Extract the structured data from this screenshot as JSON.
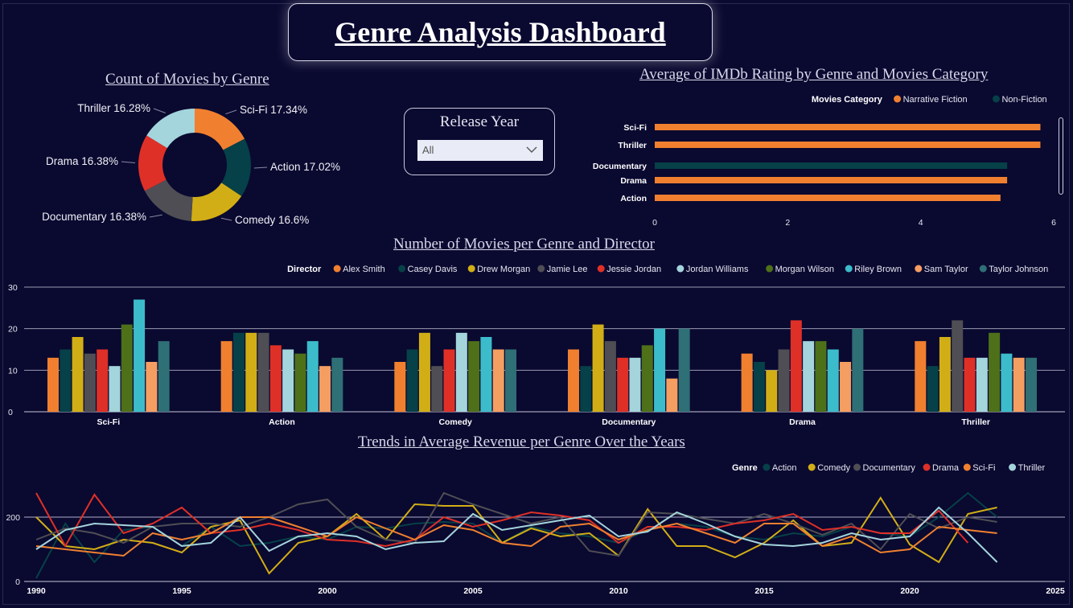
{
  "dashboard": {
    "title": "Genre Analysis Dashboard"
  },
  "slicer": {
    "title": "Release Year",
    "value": "All"
  },
  "donut": {
    "title": "Count of Movies by Genre",
    "chart_data": {
      "type": "pie",
      "title": "Count of Movies by Genre",
      "slices": [
        {
          "label": "Sci-Fi",
          "value": 17.34,
          "text": "Sci-Fi 17.34%",
          "color": "#f0802f"
        },
        {
          "label": "Action",
          "value": 17.02,
          "text": "Action 17.02%",
          "color": "#064048"
        },
        {
          "label": "Comedy",
          "value": 16.6,
          "text": "Comedy 16.6%",
          "color": "#d2ae16"
        },
        {
          "label": "Documentary",
          "value": 16.38,
          "text": "Documentary 16.38%",
          "color": "#4e4e54"
        },
        {
          "label": "Drama",
          "value": 16.38,
          "text": "Drama 16.38%",
          "color": "#df3027"
        },
        {
          "label": "Thriller",
          "value": 16.28,
          "text": "Thriller 16.28%",
          "color": "#a4d4dc"
        }
      ]
    }
  },
  "imdb": {
    "title": "Average of IMDb Rating by Genre and Movies Category",
    "legend_title": "Movies Category",
    "chart_data": {
      "type": "bar",
      "orientation": "horizontal",
      "title": "Average of IMDb Rating by Genre and Movies Category",
      "categories": [
        "Sci-Fi",
        "Thriller",
        "Documentary",
        "Drama",
        "Action"
      ],
      "series": [
        {
          "name": "Narrative Fiction",
          "color": "#f0802f",
          "values": [
            5.8,
            5.8,
            null,
            5.3,
            5.2
          ]
        },
        {
          "name": "Non-Fiction",
          "color": "#064048",
          "values": [
            null,
            null,
            5.3,
            null,
            null
          ]
        }
      ],
      "xlim": [
        0,
        6
      ],
      "xticks": [
        "0",
        "2",
        "4",
        "6"
      ]
    }
  },
  "director": {
    "title": "Number of Movies per Genre and Director",
    "legend_title": "Director",
    "chart_data": {
      "type": "bar",
      "title": "Number of Movies per Genre and Director",
      "categories": [
        "Sci-Fi",
        "Action",
        "Comedy",
        "Documentary",
        "Drama",
        "Thriller"
      ],
      "ylim": [
        0,
        30
      ],
      "yticks": [
        "0",
        "10",
        "20",
        "30"
      ],
      "grid": true,
      "series": [
        {
          "name": "Alex Smith",
          "color": "#f0802f",
          "values": [
            13,
            17,
            12,
            15,
            14,
            17
          ]
        },
        {
          "name": "Casey Davis",
          "color": "#064048",
          "values": [
            15,
            19,
            15,
            11,
            12,
            11
          ]
        },
        {
          "name": "Drew Morgan",
          "color": "#d2ae16",
          "values": [
            18,
            19,
            19,
            21,
            10,
            18
          ]
        },
        {
          "name": "Jamie Lee",
          "color": "#4e4e54",
          "values": [
            14,
            19,
            11,
            17,
            15,
            22
          ]
        },
        {
          "name": "Jessie Jordan",
          "color": "#df3027",
          "values": [
            15,
            16,
            15,
            13,
            22,
            13
          ]
        },
        {
          "name": "Jordan Williams",
          "color": "#a4d4dc",
          "values": [
            11,
            15,
            19,
            13,
            17,
            13
          ]
        },
        {
          "name": "Morgan Wilson",
          "color": "#4d7019",
          "values": [
            21,
            14,
            17,
            16,
            17,
            19
          ]
        },
        {
          "name": "Riley Brown",
          "color": "#3cbcca",
          "values": [
            27,
            17,
            18,
            20,
            15,
            14
          ]
        },
        {
          "name": "Sam Taylor",
          "color": "#f59e62",
          "values": [
            12,
            11,
            15,
            8,
            12,
            13
          ]
        },
        {
          "name": "Taylor Johnson",
          "color": "#2f6f76",
          "values": [
            17,
            13,
            15,
            20,
            20,
            13
          ]
        }
      ]
    }
  },
  "revenue": {
    "title": "Trends in Average Revenue per Genre Over the Years",
    "legend_title": "Genre",
    "chart_data": {
      "type": "line",
      "title": "Trends in Average Revenue per Genre Over the Years",
      "x": [
        1990,
        1991,
        1992,
        1993,
        1994,
        1995,
        1996,
        1997,
        1998,
        1999,
        2000,
        2001,
        2002,
        2003,
        2004,
        2005,
        2006,
        2007,
        2008,
        2009,
        2010,
        2011,
        2012,
        2013,
        2014,
        2015,
        2016,
        2017,
        2018,
        2019,
        2020,
        2021,
        2022,
        2023
      ],
      "xlim": [
        1990,
        2025
      ],
      "xticks": [
        "1990",
        "1995",
        "2000",
        "2005",
        "2010",
        "2015",
        "2020",
        "2025"
      ],
      "ylim": [
        0,
        300
      ],
      "yticks": [
        "0",
        "200"
      ],
      "series": [
        {
          "name": "Action",
          "color": "#064048",
          "values": [
            10,
            180,
            60,
            160,
            170,
            110,
            170,
            110,
            120,
            140,
            130,
            170,
            165,
            180,
            185,
            180,
            120,
            170,
            150,
            140,
            120,
            160,
            180,
            170,
            140,
            130,
            150,
            140,
            170,
            150,
            140,
            200,
            275,
            200
          ]
        },
        {
          "name": "Comedy",
          "color": "#d2ae16",
          "values": [
            200,
            110,
            100,
            130,
            120,
            90,
            170,
            190,
            25,
            120,
            140,
            210,
            130,
            240,
            235,
            235,
            120,
            165,
            140,
            150,
            80,
            225,
            110,
            110,
            75,
            120,
            190,
            110,
            120,
            260,
            115,
            60,
            210,
            230
          ]
        },
        {
          "name": "Documentary",
          "color": "#4e4e54",
          "values": [
            130,
            165,
            150,
            120,
            170,
            180,
            180,
            170,
            200,
            240,
            255,
            170,
            130,
            120,
            275,
            240,
            210,
            180,
            200,
            95,
            80,
            215,
            210,
            195,
            180,
            210,
            180,
            145,
            180,
            100,
            210,
            165,
            200,
            185
          ]
        },
        {
          "name": "Drama",
          "color": "#df3027",
          "values": [
            275,
            110,
            270,
            150,
            180,
            230,
            150,
            160,
            180,
            160,
            130,
            125,
            110,
            130,
            200,
            170,
            190,
            215,
            205,
            190,
            120,
            170,
            170,
            160,
            180,
            190,
            210,
            160,
            170,
            150,
            150,
            220,
            120,
            null
          ]
        },
        {
          "name": "Sci-Fi",
          "color": "#f0802f",
          "values": [
            110,
            100,
            90,
            80,
            150,
            130,
            150,
            200,
            200,
            170,
            140,
            200,
            165,
            130,
            175,
            160,
            120,
            110,
            170,
            180,
            130,
            160,
            180,
            150,
            120,
            180,
            180,
            110,
            140,
            90,
            100,
            170,
            160,
            150
          ]
        },
        {
          "name": "Thriller",
          "color": "#a4d4dc",
          "values": [
            100,
            160,
            180,
            175,
            170,
            110,
            120,
            200,
            95,
            140,
            150,
            140,
            100,
            120,
            125,
            210,
            160,
            175,
            190,
            205,
            140,
            155,
            215,
            180,
            140,
            115,
            110,
            120,
            150,
            130,
            140,
            230,
            150,
            60
          ]
        }
      ]
    }
  }
}
